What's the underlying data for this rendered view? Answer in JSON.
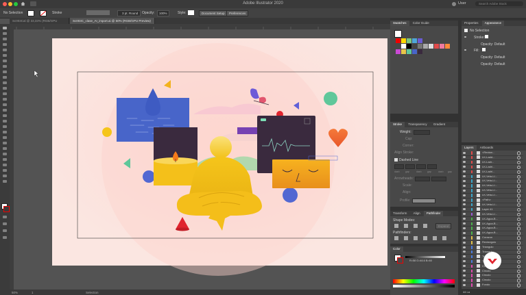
{
  "window": {
    "title": "Adobe Illustrator 2020",
    "user": "User",
    "search_placeholder": "Search Adobe Stock"
  },
  "control_bar": {
    "selection": "No Selection",
    "stroke_label": "Stroke",
    "stroke_weight": "3 pt. Round",
    "opacity_label": "Opacity:",
    "opacity_value": "100%",
    "style_label": "Style:",
    "document_setup": "Document Setup",
    "preferences": "Preferences"
  },
  "tabs": [
    {
      "label": "Sc003Cal @ 33,33% (RGB/GPU Preview)"
    },
    {
      "label": "Sc003C_clase_AI_import.ai @ 50% (RGB/GPU Preview)"
    }
  ],
  "status": {
    "zoom": "50%",
    "page": "1",
    "mode": "Selection"
  },
  "swatches_panel": {
    "tabs": [
      "Swatches",
      "Color Guide"
    ]
  },
  "properties_panel": {
    "tabs": [
      "Properties",
      "Appearance",
      "Graphic Sty"
    ],
    "selection": "No Selection",
    "stroke": "Stroke:",
    "opacity1": "Opacity: Default",
    "fill": "Fill:",
    "opacity2": "Opacity: Default",
    "opacity3": "Opacity: Default"
  },
  "stroke_panel": {
    "tabs": [
      "Stroke",
      "Transparency",
      "Gradient"
    ],
    "weight": "Weight:",
    "cap": "Cap:",
    "corner": "Corner:",
    "align": "Align Stroke:",
    "dashed": "Dashed Line",
    "dash_labels": [
      "dash",
      "gap",
      "dash",
      "gap",
      "dash",
      "gap"
    ],
    "arrowheads": "Arrowheads:",
    "scale": "Scale:",
    "align_arrow": "Align:",
    "profile": "Profile:"
  },
  "pathfinder_panel": {
    "tabs": [
      "Transform",
      "Align",
      "Pathfinder"
    ],
    "shape_modes": "Shape Modes:",
    "pathfinders": "Pathfinders:",
    "expand": "Expand"
  },
  "color_panel": {
    "tab": "Color",
    "values": "R=58 G=46.6 B=60"
  },
  "layers_panel": {
    "tabs": [
      "Layers",
      "Artboards"
    ],
    "footer": "44 La",
    "rows": [
      {
        "name": "<Rectan...",
        "color": "#e04a4a"
      },
      {
        "name": "LK-Ladd...",
        "color": "#e04a4a"
      },
      {
        "name": "LK-Ladr...",
        "color": "#e04a4a"
      },
      {
        "name": "LK-Ladri...",
        "color": "#e04a4a"
      },
      {
        "name": "LK-Ladri...",
        "color": "#e04a4a"
      },
      {
        "name": "LK-Vela-Ll...",
        "color": "#3aa6c9"
      },
      {
        "name": "LK-Vela-Ll...",
        "color": "#3aa6c9"
      },
      {
        "name": "LK-Vela-Ll...",
        "color": "#3aa6c9"
      },
      {
        "name": "LK-Vela-Ll...",
        "color": "#3aa6c9"
      },
      {
        "name": "LK-Vela-Ll...",
        "color": "#3aa6c9"
      },
      {
        "name": "<Path>",
        "color": "#3aa6c9"
      },
      {
        "name": "LK-Vela-Ll...",
        "color": "#3aa6c9"
      },
      {
        "name": "Layer 41",
        "color": "#3aa6c9"
      },
      {
        "name": "LK-Vela-Ll...",
        "color": "#9a5ad4"
      },
      {
        "name": "LK-Agua-B...",
        "color": "#4ab14a"
      },
      {
        "name": "LK-Agua-B...",
        "color": "#4ab14a"
      },
      {
        "name": "LK-Agua-B...",
        "color": "#4ab14a"
      },
      {
        "name": "LK-Agua-B...",
        "color": "#4ab14a"
      },
      {
        "name": "Corazon",
        "color": "#e0c04a"
      },
      {
        "name": "Rectangulo",
        "color": "#e0c04a"
      },
      {
        "name": "Triangulo",
        "color": "#4a7de0"
      },
      {
        "name": "Triangulo",
        "color": "#4a7de0"
      },
      {
        "name": "Triangulo",
        "color": "#4a7de0"
      },
      {
        "name": "Triangulo",
        "color": "#4a7de0"
      },
      {
        "name": "Circulo",
        "color": "#e04ab0"
      },
      {
        "name": "Circulo",
        "color": "#e04ab0"
      },
      {
        "name": "Circulo",
        "color": "#e04ab0"
      },
      {
        "name": "Circulo",
        "color": "#e04ab0"
      },
      {
        "name": "Fondo",
        "color": "#e04ab0"
      }
    ]
  },
  "swatches": [
    "#ffffff",
    "#000000",
    "#ff0000",
    "#ffff00",
    "#00ff00",
    "#00ffff",
    "#0000ff",
    "#ff00ff",
    "#cccccc",
    "#888888",
    "#e8c54a",
    "#7bc67e",
    "#4ea6d8",
    "#6a5bd4",
    "#c94ad4",
    "#e07a4a"
  ]
}
